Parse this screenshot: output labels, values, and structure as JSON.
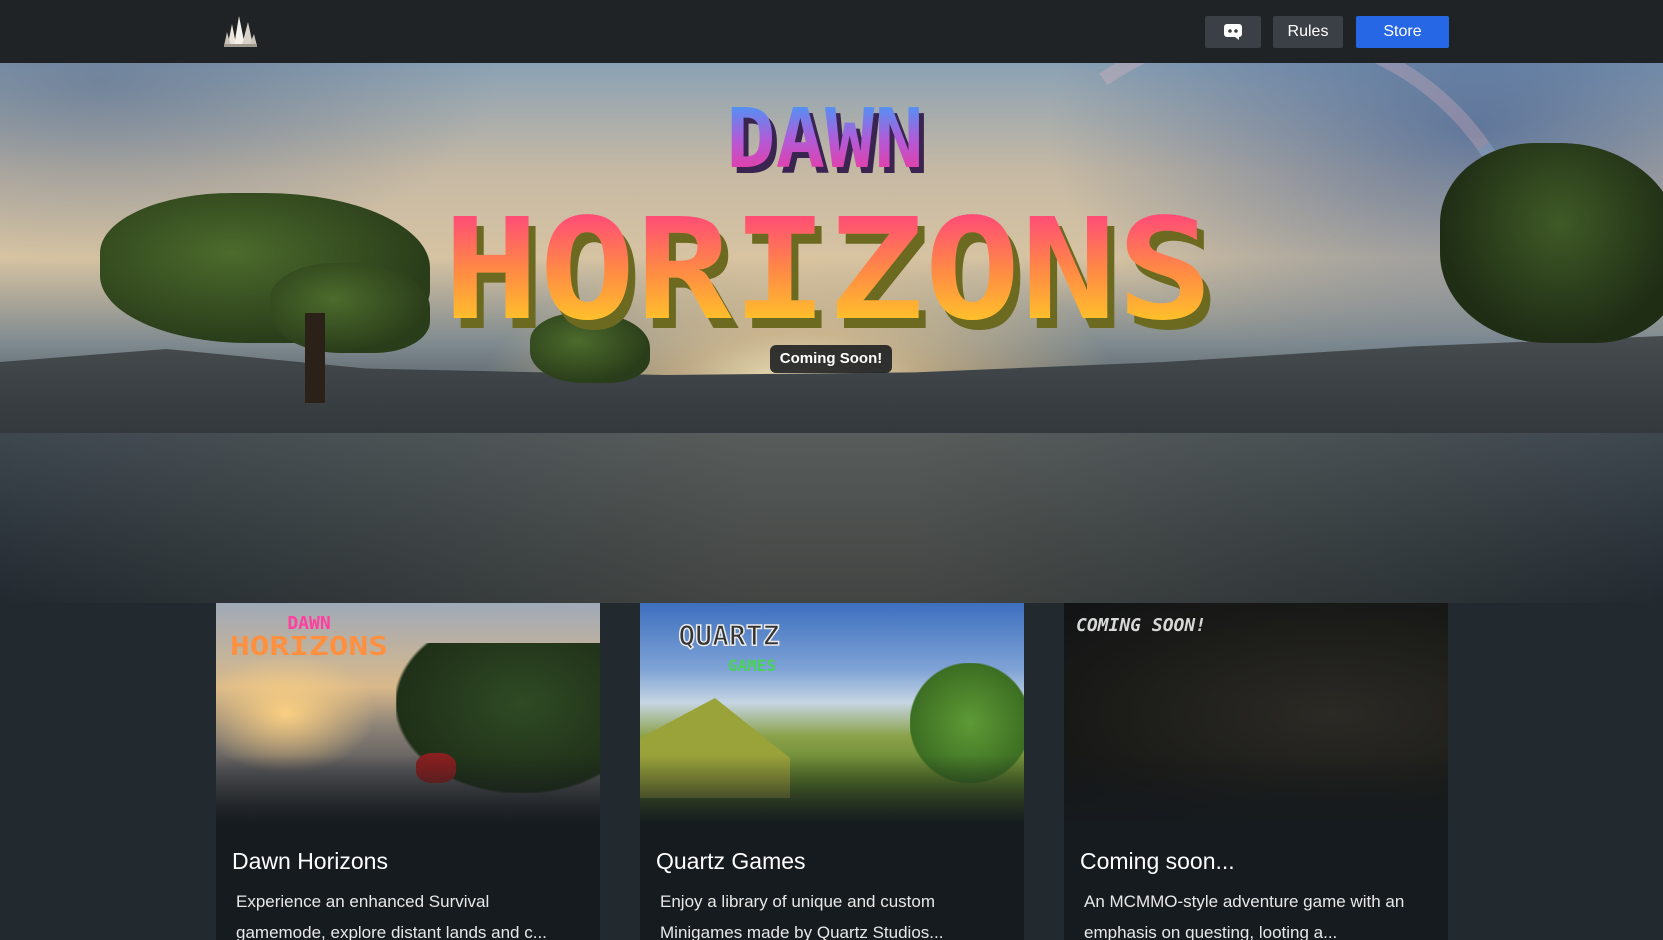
{
  "navbar": {
    "logo_icon": "quartz-crystal-icon",
    "discord_icon": "discord-icon",
    "rules_label": "Rules",
    "store_label": "Store",
    "colors": {
      "background": "#1f2326",
      "button": "#3b4046",
      "store_button": "#2667e5"
    }
  },
  "hero": {
    "logo_line_1": "DAWN",
    "logo_line_2": "HORIZONS",
    "badge": "Coming Soon!"
  },
  "cards": [
    {
      "title": "Dawn Horizons",
      "description_line_1": "Experience an enhanced Survival",
      "description_line_2": "gamemode, explore distant lands and c...",
      "image_logo_line_1": "DAWN",
      "image_logo_line_2": "HORIZONS"
    },
    {
      "title": "Quartz Games",
      "description_line_1": "Enjoy a library of unique and custom",
      "description_line_2": "Minigames made by Quartz Studios...",
      "image_logo_line_1": "QUARTZ",
      "image_logo_line_2": "GAMES"
    },
    {
      "title": "Coming soon...",
      "description_line_1": "An MCMMO-style adventure game with an",
      "description_line_2": "emphasis on questing, looting a...",
      "image_logo_line_1": "COMING SOON!"
    }
  ]
}
